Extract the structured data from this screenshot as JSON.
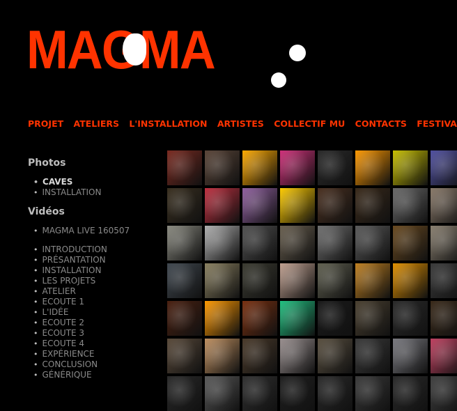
{
  "header": {
    "logo_text": "MAGMA"
  },
  "nav": [
    "PROJET",
    "ATELIERS",
    "L'INSTALLATION",
    "ARTISTES",
    "COLLECTIF MU",
    "CONTACTS",
    "FESTIVAL"
  ],
  "sidebar": {
    "photos_heading": "Photos",
    "photos": [
      "CAVES",
      "INSTALLATION"
    ],
    "videos_heading": "Vidéos",
    "videos_top": [
      "MAGMA LIVE 160507"
    ],
    "videos": [
      "INTRODUCTION",
      "PRÉSANTATION",
      "INSTALLATION",
      "LES PROJETS",
      "ATELIER",
      "ECOUTE 1",
      "L'IDÉE",
      "ECOUTE 2",
      "ECOUTE 3",
      "ECOUTE 4",
      "EXPÉRIENCE",
      "CONCLUSION",
      "GÉNÉRIQUE"
    ]
  },
  "thumbnail_colors": [
    "#7a2a20",
    "#5a4538",
    "#ffaa00",
    "#d0307a",
    "#2a2a2a",
    "#ff9900",
    "#c8c000",
    "#5050a0",
    "#3a3020",
    "#c03040",
    "#9060a0",
    "#ffcc00",
    "#4a3020",
    "#3a2a1a",
    "#6a6a6a",
    "#8a7a6a",
    "#8a8a80",
    "#b0b0b0",
    "#505050",
    "#6a6050",
    "#707070",
    "#5a5a5a",
    "#6a4a20",
    "#8a8070",
    "#404850",
    "#8a8060",
    "#3a3a30",
    "#c0a090",
    "#606050",
    "#c08020",
    "#e09000",
    "#3a3a3a",
    "#4a2010",
    "#ff9900",
    "#7a3010",
    "#20c080",
    "#1a1a1a",
    "#4a4030",
    "#2a2a2a",
    "#3a2a1a",
    "#5a4a3a",
    "#c09060",
    "#4a3a2a",
    "#9a9090",
    "#5a5040",
    "#3a3a3a",
    "#7a7a80",
    "#c04060",
    "#2a2a2a",
    "#5a5a5a",
    "#303030",
    "#202020",
    "#2a2a2a",
    "#3a3a3a",
    "#2a2a2a",
    "#404040"
  ]
}
